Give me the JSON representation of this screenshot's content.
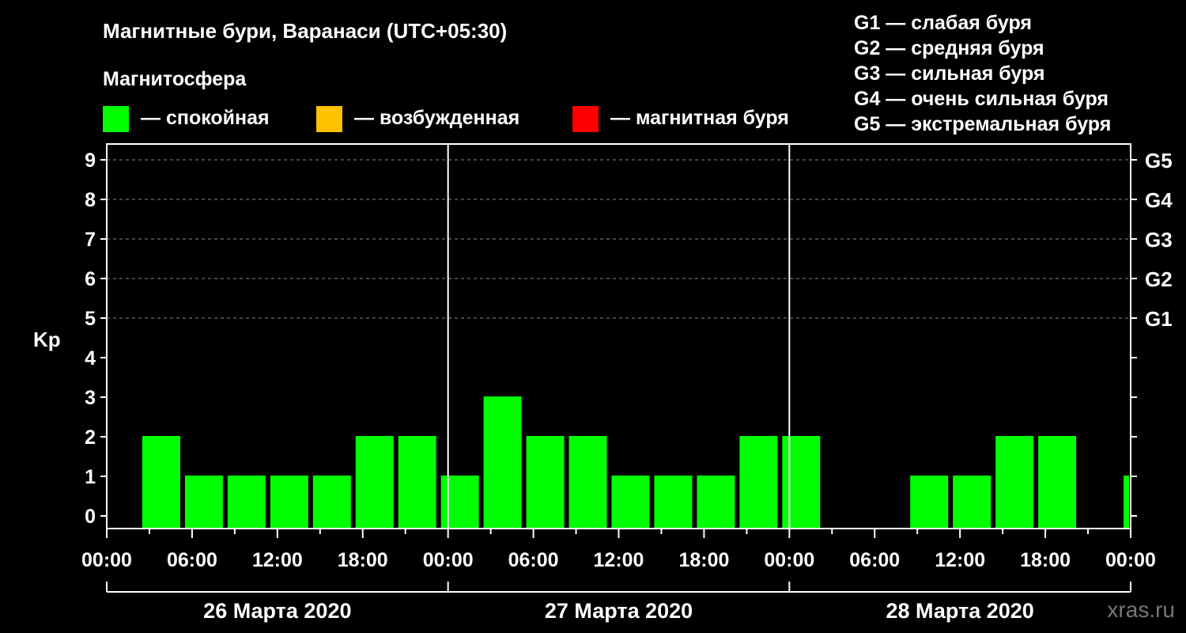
{
  "title": "Магнитные бури, Варанаси (UTC+05:30)",
  "legend": {
    "heading": "Магнитосфера",
    "items": [
      {
        "label": "— спокойная",
        "color": "#00ff00"
      },
      {
        "label": "— возбужденная",
        "color": "#ffc000"
      },
      {
        "label": "— магнитная буря",
        "color": "#ff0000"
      }
    ]
  },
  "g_scale": [
    "G1 — слабая буря",
    "G2 — средняя буря",
    "G3 — сильная буря",
    "G4 — очень сильная буря",
    "G5 — экстремальная буря"
  ],
  "credit": "xras.ru",
  "chart_data": {
    "type": "bar",
    "ylabel": "Kp",
    "ylim": [
      0,
      9
    ],
    "y_ticks": [
      "0",
      "1",
      "2",
      "3",
      "4",
      "5",
      "6",
      "7",
      "8",
      "9"
    ],
    "right_ticks": [
      {
        "kp": 5,
        "label": "G1"
      },
      {
        "kp": 6,
        "label": "G2"
      },
      {
        "kp": 7,
        "label": "G3"
      },
      {
        "kp": 8,
        "label": "G4"
      },
      {
        "kp": 9,
        "label": "G5"
      }
    ],
    "grid": "dashed horizontal at Kp 5–9",
    "x_ticks": [
      "00:00",
      "06:00",
      "12:00",
      "18:00",
      "00:00",
      "06:00",
      "12:00",
      "18:00",
      "00:00",
      "06:00",
      "12:00",
      "18:00",
      "00:00"
    ],
    "days": [
      "26 Марта 2020",
      "27 Марта 2020",
      "28 Марта 2020"
    ],
    "interval_hours": 3,
    "day_separators_hours": [
      24,
      48
    ],
    "bars": [
      {
        "start_hour": 2.5,
        "kp": 2
      },
      {
        "start_hour": 5.5,
        "kp": 1
      },
      {
        "start_hour": 8.5,
        "kp": 1
      },
      {
        "start_hour": 11.5,
        "kp": 1
      },
      {
        "start_hour": 14.5,
        "kp": 1
      },
      {
        "start_hour": 17.5,
        "kp": 2
      },
      {
        "start_hour": 20.5,
        "kp": 2
      },
      {
        "start_hour": 23.5,
        "kp": 1
      },
      {
        "start_hour": 26.5,
        "kp": 3
      },
      {
        "start_hour": 29.5,
        "kp": 2
      },
      {
        "start_hour": 32.5,
        "kp": 2
      },
      {
        "start_hour": 35.5,
        "kp": 1
      },
      {
        "start_hour": 38.5,
        "kp": 1
      },
      {
        "start_hour": 41.5,
        "kp": 1
      },
      {
        "start_hour": 44.5,
        "kp": 2
      },
      {
        "start_hour": 47.5,
        "kp": 2
      },
      {
        "start_hour": 56.5,
        "kp": 1
      },
      {
        "start_hour": 59.5,
        "kp": 1
      },
      {
        "start_hour": 62.5,
        "kp": 2
      },
      {
        "start_hour": 65.5,
        "kp": 2
      },
      {
        "start_hour": 71.5,
        "kp": 1
      }
    ],
    "x_range_hours": [
      0,
      72
    ],
    "bar_color": "#00ff00"
  }
}
